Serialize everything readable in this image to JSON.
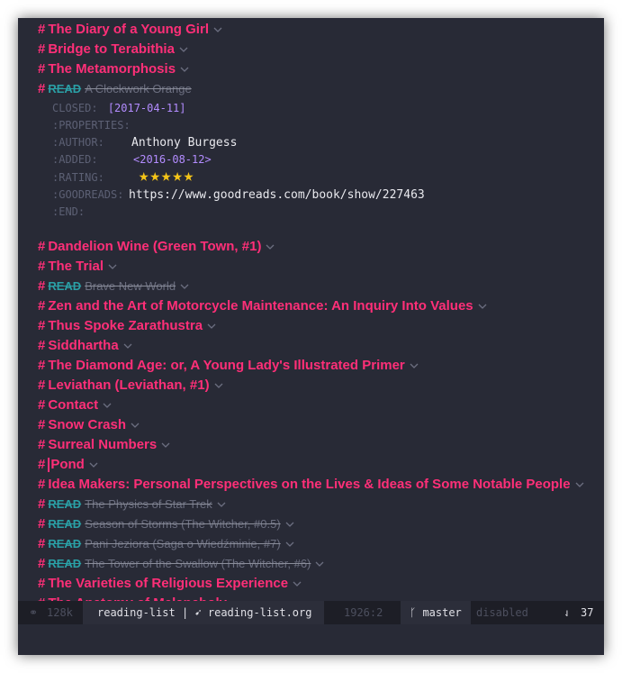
{
  "headings": [
    {
      "text": "The Diary of a Young Girl"
    },
    {
      "text": "Bridge to Terabithia"
    },
    {
      "text": "The Metamorphosis"
    }
  ],
  "clockwork": {
    "keyword": "READ",
    "title": "A Clockwork Orange",
    "closed_label": "CLOSED:",
    "closed_date": "[2017-04-11]",
    "properties_label": ":PROPERTIES:",
    "author_label": ":AUTHOR:",
    "author_value": "Anthony Burgess",
    "added_label": ":ADDED:",
    "added_value": "<2016-08-12>",
    "rating_label": ":RATING:",
    "rating_value": "★★★★★",
    "goodreads_label": ":GOODREADS:",
    "goodreads_value": "https://www.goodreads.com/book/show/227463",
    "end_label": ":END:"
  },
  "items": [
    {
      "text": "Dandelion Wine (Green Town, #1)",
      "done": false
    },
    {
      "text": "The Trial",
      "done": false
    },
    {
      "text": "Brave New World",
      "done": true
    },
    {
      "text": "Zen and the Art of Motorcycle Maintenance: An Inquiry Into Values",
      "done": false
    },
    {
      "text": "Thus Spoke Zarathustra",
      "done": false
    },
    {
      "text": "Siddhartha",
      "done": false
    },
    {
      "text": "The Diamond Age: or, A Young Lady's Illustrated Primer",
      "done": false
    },
    {
      "text": "Leviathan (Leviathan, #1)",
      "done": false
    },
    {
      "text": "Contact",
      "done": false
    },
    {
      "text": "Snow Crash",
      "done": false
    },
    {
      "text": "Surreal Numbers",
      "done": false
    },
    {
      "text": "Pond",
      "done": false,
      "cursor": true
    },
    {
      "text": "Idea Makers: Personal Perspectives on the Lives & Ideas of Some Notable People",
      "done": false
    },
    {
      "text": "The Physics of Star Trek",
      "done": true
    },
    {
      "text": "Season of Storms (The Witcher, #0.5)",
      "done": true
    },
    {
      "text": "Pani Jeziora (Saga o Wiedźminie, #7)",
      "done": true
    },
    {
      "text": "The Tower of the Swallow (The Witcher, #6)",
      "done": true
    },
    {
      "text": "The Varieties of Religious Experience",
      "done": false
    },
    {
      "text": "The Anatomy of Melancholy",
      "done": false
    }
  ],
  "done_keyword": "READ",
  "hash": "#",
  "modeline": {
    "size": "128k",
    "workspace": "reading-list",
    "separator": "|",
    "filename": "reading-list.org",
    "position": "1926:2",
    "branch": "master",
    "status": "disabled",
    "lines": "37"
  },
  "colors": {
    "background": "#282a36",
    "heading": "#ff2f78",
    "keyword": "#2aa0a6",
    "date": "#b38cff",
    "star": "#f5c518"
  }
}
